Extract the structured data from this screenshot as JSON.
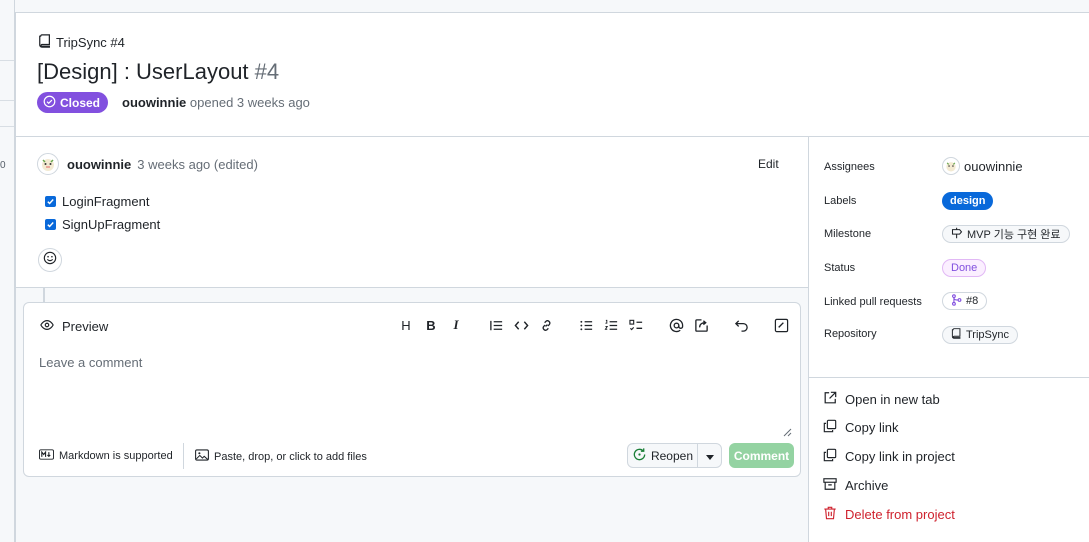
{
  "header": {
    "breadcrumb": "TripSync #4",
    "title": "[Design] : UserLayout",
    "number": "#4",
    "state": "Closed",
    "author": "ouowinnie",
    "opened_text": "opened 3 weeks ago"
  },
  "background": {
    "counter": "0"
  },
  "comment": {
    "author": "ouowinnie",
    "meta": "3 weeks ago (edited)",
    "edit_label": "Edit",
    "tasks": [
      {
        "label": "LoginFragment",
        "checked": true
      },
      {
        "label": "SignUpFragment",
        "checked": true
      }
    ]
  },
  "editor": {
    "tab_label": "Preview",
    "placeholder": "Leave a comment",
    "markdown_note": "Markdown is supported",
    "attach_note": "Paste, drop, or click to add files",
    "reopen_label": "Reopen",
    "comment_label": "Comment",
    "toolbar": {
      "heading": "H",
      "bold": "B",
      "italic": "I"
    }
  },
  "sidebar": {
    "assignees_label": "Assignees",
    "assignee": "ouowinnie",
    "labels_label": "Labels",
    "label_value": "design",
    "milestone_label": "Milestone",
    "milestone_value": "MVP 기능 구현 완료",
    "status_label": "Status",
    "status_value": "Done",
    "linked_label": "Linked pull requests",
    "linked_value": "#8",
    "repo_label": "Repository",
    "repo_value": "TripSync",
    "actions": {
      "open_new_tab": "Open in new tab",
      "copy_link": "Copy link",
      "copy_link_project": "Copy link in project",
      "archive": "Archive",
      "delete": "Delete from project"
    }
  },
  "colors": {
    "closed": "#8250df",
    "design_label": "#0969da",
    "done": "#8250df",
    "comment_button": "#94d3a2",
    "danger": "#cf222e"
  }
}
